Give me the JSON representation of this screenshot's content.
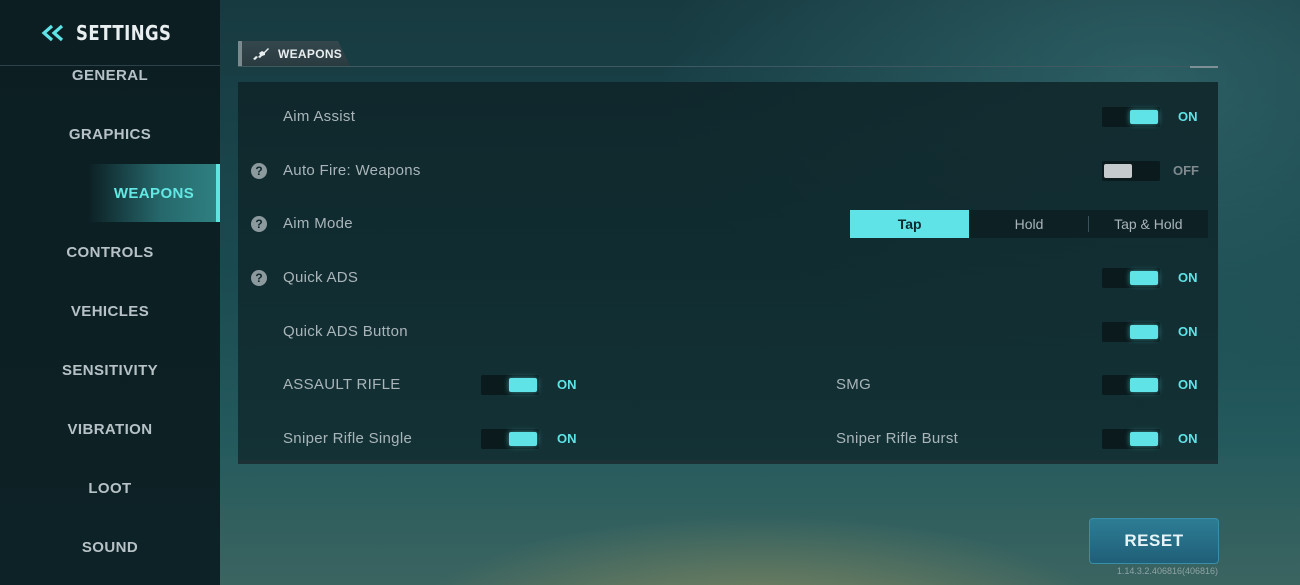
{
  "sidebar": {
    "title": "SETTINGS",
    "back_icon": "double-chevron-left-icon",
    "items": [
      {
        "label": "GENERAL",
        "active": false
      },
      {
        "label": "GRAPHICS",
        "active": false
      },
      {
        "label": "WEAPONS",
        "active": true
      },
      {
        "label": "CONTROLS",
        "active": false
      },
      {
        "label": "VEHICLES",
        "active": false
      },
      {
        "label": "SENSITIVITY",
        "active": false
      },
      {
        "label": "VIBRATION",
        "active": false
      },
      {
        "label": "LOOT",
        "active": false
      },
      {
        "label": "SOUND",
        "active": false
      }
    ]
  },
  "section": {
    "tab_label": "WEAPONS",
    "tab_icon": "rifle-icon"
  },
  "settings": {
    "aim_assist": {
      "label": "Aim Assist",
      "state": "ON",
      "enabled": true
    },
    "auto_fire": {
      "label": "Auto Fire: Weapons",
      "state": "OFF",
      "enabled": false
    },
    "aim_mode": {
      "label": "Aim Mode",
      "options": [
        "Tap",
        "Hold",
        "Tap & Hold"
      ],
      "selected": "Tap"
    },
    "quick_ads": {
      "label": "Quick ADS",
      "state": "ON",
      "enabled": true
    },
    "quick_ads_button": {
      "label": "Quick ADS Button",
      "state": "ON",
      "enabled": true
    },
    "assault_rifle": {
      "label": "ASSAULT RIFLE",
      "state": "ON",
      "enabled": true
    },
    "smg": {
      "label": "SMG",
      "state": "ON",
      "enabled": true
    },
    "sniper_single": {
      "label": "Sniper Rifle Single",
      "state": "ON",
      "enabled": true
    },
    "sniper_burst": {
      "label": "Sniper Rifle Burst",
      "state": "ON",
      "enabled": true
    }
  },
  "help_icon": "?",
  "reset_label": "RESET",
  "version": "1.14.3.2.406816(406816)",
  "colors": {
    "accent": "#5fe3e6",
    "sidebar_bg": "#0c1e22",
    "reset_button": "#2d7d95"
  }
}
